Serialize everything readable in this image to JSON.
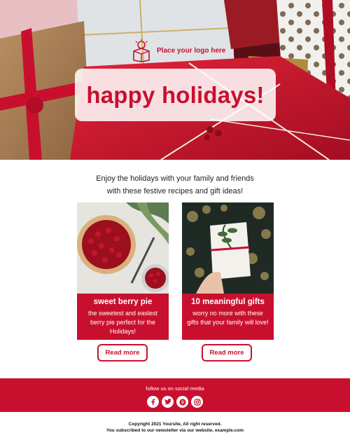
{
  "header": {
    "logo_text": "Place your logo here",
    "title": "happy holidays!"
  },
  "intro": {
    "line1": "Enjoy the holidays with your family and friends",
    "line2": "with these festive recipes and gift ideas!"
  },
  "cards": [
    {
      "title": "sweet berry pie",
      "body": "the sweetest and easlest berry pie perfect for the Holidays!",
      "button_label": "Read more"
    },
    {
      "title": "10 meaningful gifts",
      "body": "worry no more with these gifts that your family will love!",
      "button_label": "Read more"
    }
  ],
  "footer": {
    "follow_text": "follow us on social media",
    "social_icons": [
      "facebook-icon",
      "twitter-icon",
      "pinterest-icon",
      "instagram-icon"
    ]
  },
  "legal": {
    "copyright": "Copyright 2021 Yoursite, All right reserved.",
    "subscribed": "You subscribed to our newsletter via our website, example.com"
  },
  "colors": {
    "accent": "#c8102e",
    "background": "#ffffff"
  }
}
